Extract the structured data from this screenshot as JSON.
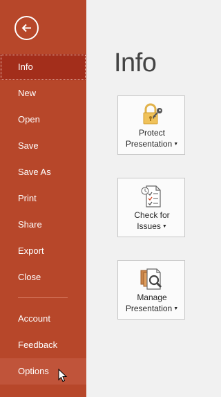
{
  "sidebar": {
    "back_icon": "back-arrow-icon",
    "items": [
      {
        "label": "Info"
      },
      {
        "label": "New"
      },
      {
        "label": "Open"
      },
      {
        "label": "Save"
      },
      {
        "label": "Save As"
      },
      {
        "label": "Print"
      },
      {
        "label": "Share"
      },
      {
        "label": "Export"
      },
      {
        "label": "Close"
      },
      {
        "label": "Account"
      },
      {
        "label": "Feedback"
      },
      {
        "label": "Options"
      }
    ],
    "active_item": "Info",
    "hovered_item": "Options",
    "colors": {
      "background": "#b7472a",
      "active": "#a32e1b",
      "hover": "#c0543a"
    }
  },
  "main": {
    "title": "Info",
    "cards": [
      {
        "line1": "Protect",
        "line2": "Presentation",
        "icon": "lock-key-icon"
      },
      {
        "line1": "Check for",
        "line2": "Issues",
        "icon": "checklist-icon"
      },
      {
        "line1": "Manage",
        "line2": "Presentation",
        "icon": "manage-documents-icon"
      }
    ]
  }
}
